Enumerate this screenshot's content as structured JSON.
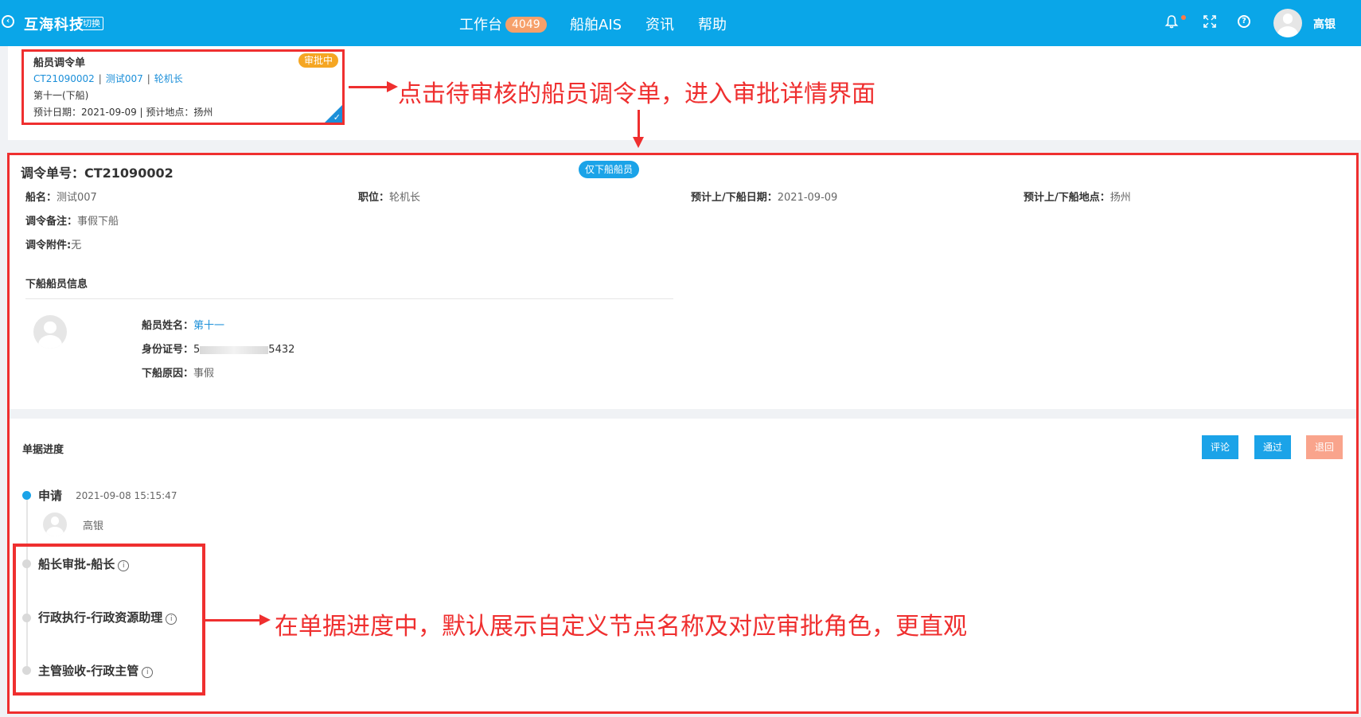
{
  "header": {
    "brand": "互海科技",
    "switch_label": "切换",
    "nav": {
      "workbench": "工作台",
      "workbench_badge": "4049",
      "ais": "船舶AIS",
      "news": "资讯",
      "help": "帮助"
    },
    "user_name": "高银"
  },
  "order_card": {
    "title": "船员调令单",
    "status": "审批中",
    "order_no": "CT21090002",
    "ship": "测试007",
    "position": "轮机长",
    "crew": "第十一(下船)",
    "date_line": "预计日期：2021-09-09 | 预计地点：扬州"
  },
  "annotations": {
    "top": "点击待审核的船员调令单，进入审批详情界面",
    "bottom": "在单据进度中，默认展示自定义节点名称及对应审批角色，更直观"
  },
  "detail": {
    "order_no": "调令单号：CT21090002",
    "onboard_tag": "仅下船船员",
    "ship_label": "船名：",
    "ship_value": "测试007",
    "position_label": "职位：",
    "position_value": "轮机长",
    "date_label": "预计上/下船日期：",
    "date_value": "2021-09-09",
    "place_label": "预计上/下船地点：",
    "place_value": "扬州",
    "remark_label": "调令备注：",
    "remark_value": "事假下船",
    "attach_label": "调令附件:",
    "attach_value": "无",
    "section_title": "下船船员信息",
    "crew_name_label": "船员姓名：",
    "crew_name_value": "第十一",
    "id_label": "身份证号：",
    "id_prefix": "5",
    "id_suffix": "5432",
    "reason_label": "下船原因：",
    "reason_value": "事假"
  },
  "progress": {
    "title": "单据进度",
    "buttons": {
      "comment": "评论",
      "approve": "通过",
      "return": "退回"
    },
    "apply_label": "申请",
    "apply_time": "2021-09-08 15:15:47",
    "applicant": "高银",
    "steps": [
      "船长审批-船长",
      "行政执行-行政资源助理",
      "主管验收-行政主管"
    ]
  }
}
